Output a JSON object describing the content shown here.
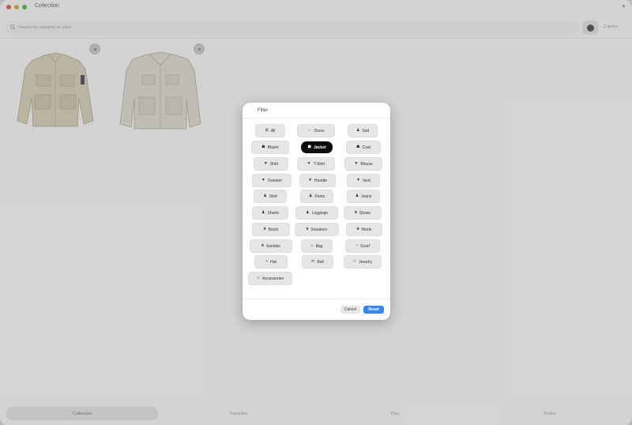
{
  "window": {
    "title": "Collection",
    "add_label": "+"
  },
  "search": {
    "placeholder": "Search by category or color"
  },
  "item_count": "2 items",
  "tabs": [
    {
      "label": "Collection",
      "active": true
    },
    {
      "label": "Favorites",
      "active": false
    },
    {
      "label": "Plan",
      "active": false
    },
    {
      "label": "Profile",
      "active": false
    }
  ],
  "items": [
    {
      "name": "jacket-1"
    },
    {
      "name": "jacket-2"
    }
  ],
  "filter": {
    "title": "Filter",
    "selected": "Jacket",
    "cancel_label": "Cancel",
    "reset_label": "Reset",
    "chips": [
      {
        "label": "All",
        "icon": "grid-icon"
      },
      {
        "label": "Dress",
        "icon": "dress-icon"
      },
      {
        "label": "Suit",
        "icon": "person-icon"
      },
      {
        "label": "Blazer",
        "icon": "jacket-icon"
      },
      {
        "label": "Jacket",
        "icon": "jacket-icon"
      },
      {
        "label": "Coat",
        "icon": "jacket-icon"
      },
      {
        "label": "Shirt",
        "icon": "tshirt-icon"
      },
      {
        "label": "T-Shirt",
        "icon": "tshirt-icon"
      },
      {
        "label": "Blouse",
        "icon": "tshirt-icon"
      },
      {
        "label": "Sweater",
        "icon": "tshirt-icon"
      },
      {
        "label": "Hoodie",
        "icon": "tshirt-icon"
      },
      {
        "label": "Vest",
        "icon": "tshirt-icon"
      },
      {
        "label": "Skirt",
        "icon": "person-icon"
      },
      {
        "label": "Pants",
        "icon": "person-icon"
      },
      {
        "label": "Jeans",
        "icon": "person-icon"
      },
      {
        "label": "Shorts",
        "icon": "person-icon"
      },
      {
        "label": "Leggings",
        "icon": "person-icon"
      },
      {
        "label": "Shoes",
        "icon": "shoe-icon"
      },
      {
        "label": "Boots",
        "icon": "shoe-icon"
      },
      {
        "label": "Sneakers",
        "icon": "shoe-icon"
      },
      {
        "label": "Heels",
        "icon": "shoe-icon"
      },
      {
        "label": "Sandals",
        "icon": "shoe-icon"
      },
      {
        "label": "Bag",
        "icon": "bag-icon"
      },
      {
        "label": "Scarf",
        "icon": "scarf-icon"
      },
      {
        "label": "Hat",
        "icon": "hat-icon"
      },
      {
        "label": "Belt",
        "icon": "belt-icon"
      },
      {
        "label": "Jewelry",
        "icon": "jewelry-icon"
      },
      {
        "label": "Accessories",
        "icon": "accessories-icon"
      }
    ]
  },
  "colors": {
    "accent": "#3a86f0",
    "selected_chip": "#0c0c0c"
  }
}
